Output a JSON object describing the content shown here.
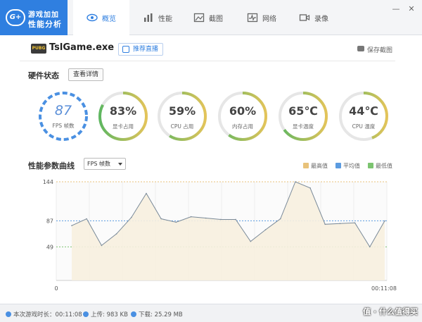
{
  "app": {
    "logo_line1": "游戏加加",
    "logo_line2": "性能分析",
    "logo_badge": "G+"
  },
  "tabs": [
    {
      "label": "概览",
      "icon": "eye-icon",
      "active": true
    },
    {
      "label": "性能",
      "icon": "bar-chart-icon",
      "active": false
    },
    {
      "label": "截图",
      "icon": "image-icon",
      "active": false
    },
    {
      "label": "网络",
      "icon": "pulse-icon",
      "active": false
    },
    {
      "label": "录像",
      "icon": "video-icon",
      "active": false
    }
  ],
  "window": {
    "minimize": "—",
    "close": "✕"
  },
  "game": {
    "logo_text": "PUBG",
    "title": "TslGame.exe",
    "live_label": "推荐直播",
    "save_label": "保存截图"
  },
  "hardware": {
    "title": "硬件状态",
    "detail_label": "查看详情",
    "gauges": [
      {
        "id": "fps",
        "value": "87",
        "label": "FPS 帧数",
        "level": 1.0,
        "color": "#4a90e2"
      },
      {
        "id": "gpu",
        "value": "83%",
        "label": "显卡占用",
        "level": 0.83,
        "color": "#72b85c"
      },
      {
        "id": "cpu",
        "value": "59%",
        "label": "CPU 占用",
        "level": 0.59,
        "color": "#72b85c"
      },
      {
        "id": "mem",
        "value": "60%",
        "label": "内存占用",
        "level": 0.6,
        "color": "#72b85c"
      },
      {
        "id": "gputemp",
        "value": "65℃",
        "label": "显卡温度",
        "level": 0.65,
        "color": "#72b85c"
      },
      {
        "id": "cputemp",
        "value": "44℃",
        "label": "CPU 温度",
        "level": 0.44,
        "color": "#72b85c"
      }
    ]
  },
  "curve": {
    "title": "性能参数曲线",
    "select_value": "FPS 帧数",
    "legend": [
      {
        "label": "最高值",
        "color": "#e8c27a"
      },
      {
        "label": "平均值",
        "color": "#5b9be0"
      },
      {
        "label": "最低值",
        "color": "#7cc470"
      }
    ]
  },
  "chart_data": {
    "type": "area",
    "y_ticks": [
      "144",
      "87",
      "49",
      "0"
    ],
    "x_start_label": "0",
    "x_end_label": "00:11:08",
    "max": 144,
    "avg": 87,
    "min": 49,
    "ylim": [
      0,
      144
    ],
    "series": [
      {
        "values": [
          80,
          90,
          51,
          68,
          92,
          127,
          90,
          85,
          93,
          91,
          89,
          89,
          57,
          74,
          90,
          144,
          135,
          82,
          83,
          84,
          49,
          87
        ]
      }
    ]
  },
  "status": {
    "duration_label": "本次游戏时长：",
    "duration_value": "00:11:08",
    "upload_label": "上传: 983 KB",
    "download_label": "下载: 25.29 MB"
  },
  "watermark": "值 · 什么值得买",
  "colors": {
    "accent": "#2f7fe0",
    "gauge_bg": "#e6e6e6"
  }
}
